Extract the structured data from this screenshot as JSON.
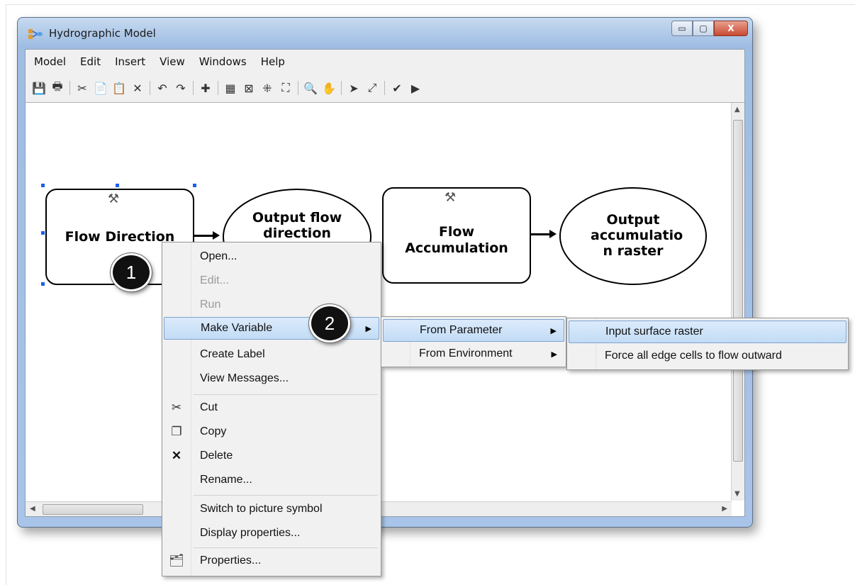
{
  "window": {
    "title": "Hydrographic Model",
    "buttons": {
      "minimize": "▭",
      "maximize": "▢",
      "close": "X"
    }
  },
  "menubar": [
    "Model",
    "Edit",
    "Insert",
    "View",
    "Windows",
    "Help"
  ],
  "toolbar": [
    {
      "name": "save-icon",
      "glyph": "💾"
    },
    {
      "name": "print-icon",
      "glyph": "🖶"
    },
    {
      "name": "sep"
    },
    {
      "name": "cut-icon",
      "glyph": "✂"
    },
    {
      "name": "copy-icon",
      "glyph": "📄"
    },
    {
      "name": "paste-icon",
      "glyph": "📋"
    },
    {
      "name": "delete-icon",
      "glyph": "✕"
    },
    {
      "name": "sep"
    },
    {
      "name": "undo-icon",
      "glyph": "↶"
    },
    {
      "name": "redo-icon",
      "glyph": "↷"
    },
    {
      "name": "sep"
    },
    {
      "name": "add-data-icon",
      "glyph": "✚"
    },
    {
      "name": "sep"
    },
    {
      "name": "auto-layout-icon",
      "glyph": "▦"
    },
    {
      "name": "full-extent-icon",
      "glyph": "⊠"
    },
    {
      "name": "fixed-zoom-in-icon",
      "glyph": "⁜"
    },
    {
      "name": "fixed-zoom-out-icon",
      "glyph": "⛶"
    },
    {
      "name": "sep"
    },
    {
      "name": "zoom-in-icon",
      "glyph": "🔍"
    },
    {
      "name": "pan-icon",
      "glyph": "✋"
    },
    {
      "name": "sep"
    },
    {
      "name": "select-icon",
      "glyph": "➤"
    },
    {
      "name": "connect-icon",
      "glyph": "⤢"
    },
    {
      "name": "sep"
    },
    {
      "name": "validate-icon",
      "glyph": "✔"
    },
    {
      "name": "run-icon",
      "glyph": "▶"
    }
  ],
  "model": {
    "flow_direction": "Flow Direction",
    "output_flow_direction": "Output flow direction",
    "flow_accumulation": "Flow Accumulation",
    "output_accumulation": "Output accumulatio n raster"
  },
  "callouts": {
    "one": "1",
    "two": "2"
  },
  "context_menu": {
    "open": "Open...",
    "edit": "Edit...",
    "run": "Run",
    "make_variable": "Make Variable",
    "create_label": "Create Label",
    "view_messages": "View Messages...",
    "cut": "Cut",
    "copy": "Copy",
    "delete": "Delete",
    "rename": "Rename...",
    "switch_picture": "Switch to picture symbol",
    "display_properties": "Display properties...",
    "properties": "Properties..."
  },
  "submenu_variable": {
    "from_parameter": "From Parameter",
    "from_environment": "From Environment"
  },
  "submenu_parameter": {
    "input_surface": "Input surface raster",
    "force_edge": "Force all edge cells to flow outward"
  },
  "colors": {
    "highlight_border": "#7da2ce",
    "handle": "#1a5ff0",
    "close_button": "#c84a33"
  }
}
